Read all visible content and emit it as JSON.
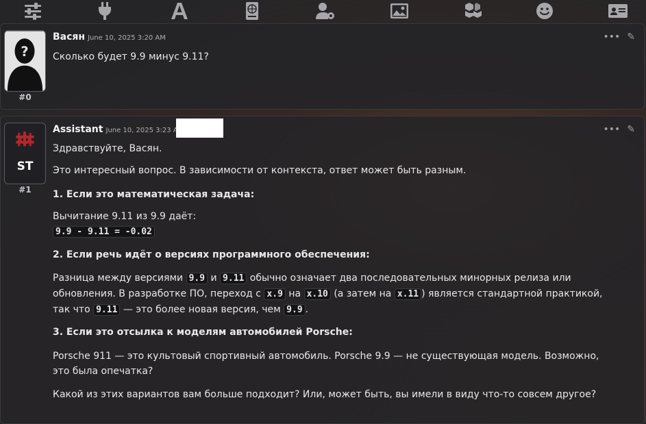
{
  "toolbar": {
    "icons": [
      "sliders-icon",
      "plug-icon",
      "font-icon",
      "book-globe-icon",
      "user-gear-icon",
      "image-icon",
      "cubes-icon",
      "smile-icon",
      "id-card-icon"
    ]
  },
  "messages": [
    {
      "author": "Васян",
      "timestamp": "June 10, 2025 3:20 AM",
      "mesid": "#0",
      "text": "Сколько будет 9.9 минус 9.11?"
    },
    {
      "author": "Assistant",
      "timestamp": "June 10, 2025 3:23 AM",
      "mesid": "#1",
      "avatar_text": "ST",
      "greeting": "Здравствуйте, Васян.",
      "intro": "Это интересный вопрос. В зависимости от контекста, ответ может быть разным.",
      "h1": "1. Если это математическая задача:",
      "math_line": "Вычитание 9.11 из 9.9 даёт:",
      "math_code": "9.9 - 9.11 = -0.02",
      "h2": "2. Если речь идёт о версиях программного обеспечения:",
      "v_a": "Разница между версиями ",
      "v_code1": "9.9",
      "v_b": " и ",
      "v_code2": "9.11",
      "v_c": " обычно означает два последовательных минорных релиза или",
      "v2_a": "обновления. В разработке ПО, переход с ",
      "v2_code1": "x.9",
      "v2_b": " на ",
      "v2_code2": "x.10",
      "v2_c": " (а затем на ",
      "v2_code3": "x.11",
      "v2_d": ") является стандартной практикой,",
      "v3_a": "так что ",
      "v3_code1": "9.11",
      "v3_b": " — это более новая версия, чем ",
      "v3_code2": "9.9",
      "v3_c": ".",
      "h3": "3. Если это отсылка к моделям автомобилей Porsche:",
      "porsche1": "Porsche 911 — это культовый спортивный автомобиль. Porsche 9.9 — не существующая модель. Возможно,",
      "porsche2": "это была опечатка?",
      "closing": "Какой из этих вариантов вам больше подходит? Или, может быть, вы имели в виду что-то совсем другое?"
    }
  ],
  "controls": {
    "more": "•••",
    "edit": "✎"
  }
}
